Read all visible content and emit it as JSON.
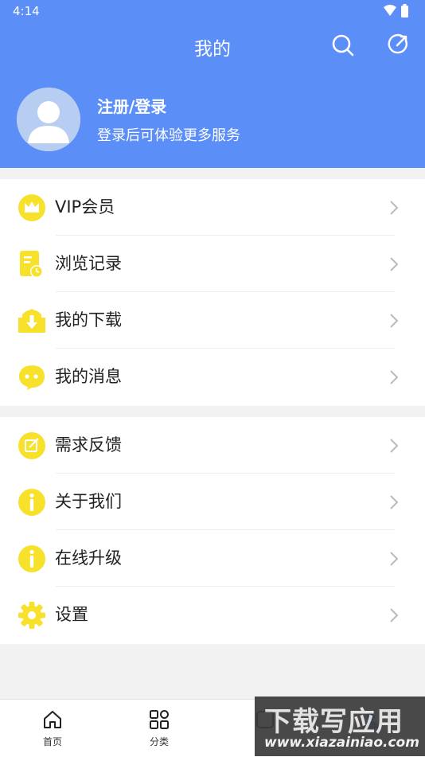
{
  "status_bar": {
    "time": "4:14"
  },
  "header": {
    "title": "我的"
  },
  "profile": {
    "login_title": "注册/登录",
    "login_subtitle": "登录后可体验更多服务"
  },
  "group1": [
    {
      "label": "VIP会员",
      "icon": "crown-icon"
    },
    {
      "label": "浏览记录",
      "icon": "history-icon"
    },
    {
      "label": "我的下载",
      "icon": "download-icon"
    },
    {
      "label": "我的消息",
      "icon": "message-icon"
    }
  ],
  "group2": [
    {
      "label": "需求反馈",
      "icon": "feedback-icon"
    },
    {
      "label": "关于我们",
      "icon": "info-icon"
    },
    {
      "label": "在线升级",
      "icon": "info-icon"
    },
    {
      "label": "设置",
      "icon": "gear-icon"
    }
  ],
  "tabbar": [
    {
      "label": "首页",
      "icon": "home-icon"
    },
    {
      "label": "分类",
      "icon": "category-icon"
    },
    {
      "label": "",
      "icon": "app-icon"
    },
    {
      "label": "",
      "icon": "profile-icon"
    }
  ],
  "watermark": {
    "text": "下载写应用",
    "url": "www.xiazainiao.com"
  },
  "colors": {
    "header_bg": "#5b8ef7",
    "accent_yellow": "#f7e12b",
    "page_bg": "#f2f2f2"
  }
}
